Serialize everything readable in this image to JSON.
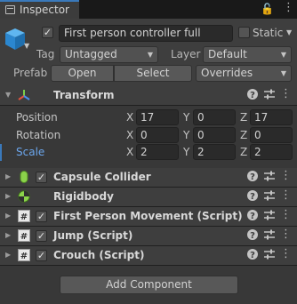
{
  "tab": {
    "label": "Inspector"
  },
  "gameobject": {
    "active": true,
    "name": "First person controller full",
    "static_label": "Static",
    "static_checked": false,
    "tag_label": "Tag",
    "tag_value": "Untagged",
    "layer_label": "Layer",
    "layer_value": "Default",
    "prefab_label": "Prefab",
    "open_label": "Open",
    "select_label": "Select",
    "overrides_label": "Overrides"
  },
  "transform": {
    "name": "Transform",
    "position": {
      "label": "Position",
      "x": "17",
      "y": "0",
      "z": "17"
    },
    "rotation": {
      "label": "Rotation",
      "x": "0",
      "y": "0",
      "z": "0"
    },
    "scale": {
      "label": "Scale",
      "x": "2",
      "y": "2",
      "z": "2"
    },
    "axis_x": "X",
    "axis_y": "Y",
    "axis_z": "Z"
  },
  "components": [
    {
      "name": "Capsule Collider",
      "enabled": true,
      "icon": "capsule-collider-icon"
    },
    {
      "name": "Rigidbody",
      "enabled": null,
      "icon": "rigidbody-icon"
    },
    {
      "name": "First Person Movement (Script)",
      "enabled": true,
      "icon": "script-icon"
    },
    {
      "name": "Jump (Script)",
      "enabled": true,
      "icon": "script-icon"
    },
    {
      "name": "Crouch (Script)",
      "enabled": true,
      "icon": "script-icon"
    }
  ],
  "add_component_label": "Add Component",
  "colors": {
    "accent": "#3a79bb",
    "scale_label": "#6ca7ee",
    "panel": "#383838",
    "header": "#3e3e3e"
  }
}
